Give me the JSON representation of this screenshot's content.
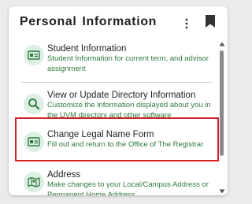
{
  "card": {
    "title": "Personal Information"
  },
  "colors": {
    "accent_green": "#2f7a3c",
    "icon_bg": "#dcefe3",
    "highlight_red": "#d32027"
  },
  "items": [
    {
      "label": "Student Information",
      "description": "Student Information for current term, and advisor assignment",
      "icon": "id-card-icon"
    },
    {
      "label": "View or Update Directory Information",
      "description": "Customize the information displayed about you in the UVM directory and other software",
      "icon": "search-icon"
    },
    {
      "label": "Change Legal Name Form",
      "description": "Fill out and return to the Office of The Registrar",
      "icon": "id-card-icon"
    },
    {
      "label": "Address",
      "description": "Make changes to your Local/Campus Address or Permanent Home Address",
      "icon": "map-icon"
    }
  ]
}
